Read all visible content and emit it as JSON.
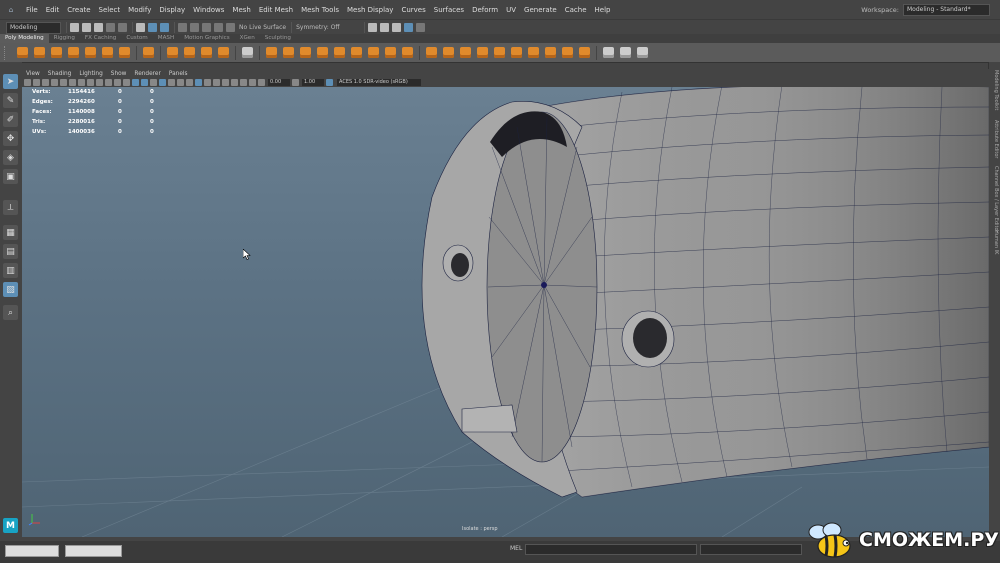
{
  "menubar": {
    "items": [
      "File",
      "Edit",
      "Create",
      "Select",
      "Modify",
      "Display",
      "Windows",
      "Mesh",
      "Edit Mesh",
      "Mesh Tools",
      "Mesh Display",
      "Curves",
      "Surfaces",
      "Deform",
      "UV",
      "Generate",
      "Cache",
      "Help"
    ],
    "workspace_label": "Workspace:",
    "workspace_value": "Modeling - Standard*"
  },
  "statusline": {
    "mode": "Modeling",
    "live_surface": "No Live Surface",
    "symmetry": "Symmetry: Off"
  },
  "shelf": {
    "tabs": [
      "Poly Modeling",
      "Rigging",
      "FX Caching",
      "Custom",
      "MASH",
      "Motion Graphics",
      "XGen",
      "Sculpting"
    ],
    "active_tab": 0
  },
  "viewport": {
    "menu": [
      "View",
      "Shading",
      "Lighting",
      "Show",
      "Renderer",
      "Panels"
    ],
    "near_value": "0.00",
    "far_value": "1.00",
    "colorspace": "ACES 1.0 SDR-video (sRGB)",
    "camera_label": "Isolate : persp",
    "hud": [
      {
        "label": "Verts:",
        "value": "1154416",
        "c1": "0",
        "c2": "0"
      },
      {
        "label": "Edges:",
        "value": "2294260",
        "c1": "0",
        "c2": "0"
      },
      {
        "label": "Faces:",
        "value": "1140008",
        "c1": "0",
        "c2": "0"
      },
      {
        "label": "Tris:",
        "value": "2280016",
        "c1": "0",
        "c2": "0"
      },
      {
        "label": "UVs:",
        "value": "1400036",
        "c1": "0",
        "c2": "0"
      }
    ]
  },
  "right_panel": {
    "tabs": [
      "Modeling Toolkit",
      "Attribute Editor",
      "Channel Box / Layer Editor",
      "Human IK"
    ]
  },
  "commandline": {
    "mel_label": "MEL"
  },
  "watermark": {
    "text": "СМОЖЕМ.РУ"
  },
  "colors": {
    "shelf_icon": "#e08a2c",
    "selected": "#5d8fb6",
    "viewport_top": "#6a8092",
    "viewport_bottom": "#4f6474"
  }
}
